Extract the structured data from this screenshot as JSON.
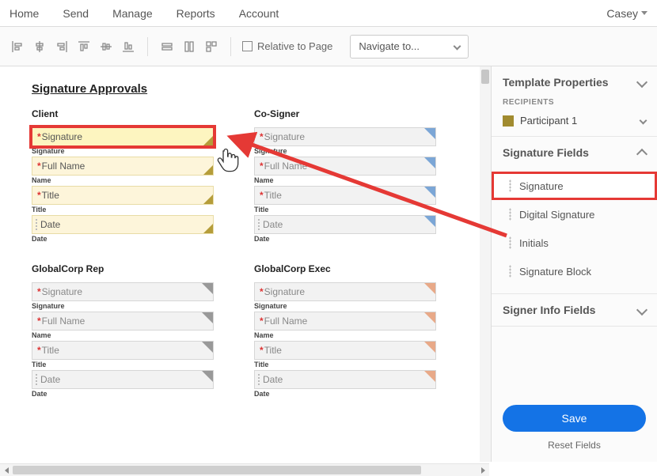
{
  "topnav": {
    "items": [
      "Home",
      "Send",
      "Manage",
      "Reports",
      "Account"
    ],
    "user": "Casey"
  },
  "toolbar": {
    "relative_label": "Relative to Page",
    "navigate_label": "Navigate to..."
  },
  "document": {
    "title": "Signature Approvals",
    "blocks": [
      {
        "heading": "Client",
        "tone": "yellow",
        "selected_field": 0,
        "fields": [
          {
            "placeholder": "Signature",
            "required": true,
            "label": "Signature"
          },
          {
            "placeholder": "Full Name",
            "required": true,
            "label": "Name"
          },
          {
            "placeholder": "Title",
            "required": true,
            "label": "Title"
          },
          {
            "placeholder": "Date",
            "required": false,
            "label": "Date",
            "date": true
          }
        ]
      },
      {
        "heading": "Co-Signer",
        "tone": "blue",
        "fields": [
          {
            "placeholder": "Signature",
            "required": true,
            "label": "Signature"
          },
          {
            "placeholder": "Full Name",
            "required": true,
            "label": "Name"
          },
          {
            "placeholder": "Title",
            "required": true,
            "label": "Title"
          },
          {
            "placeholder": "Date",
            "required": false,
            "label": "Date",
            "date": true
          }
        ]
      },
      {
        "heading": "GlobalCorp Rep",
        "tone": "grey",
        "fields": [
          {
            "placeholder": "Signature",
            "required": true,
            "label": "Signature"
          },
          {
            "placeholder": "Full Name",
            "required": true,
            "label": "Name"
          },
          {
            "placeholder": "Title",
            "required": true,
            "label": "Title"
          },
          {
            "placeholder": "Date",
            "required": false,
            "label": "Date",
            "date": true
          }
        ]
      },
      {
        "heading": "GlobalCorp Exec",
        "tone": "orange",
        "fields": [
          {
            "placeholder": "Signature",
            "required": true,
            "label": "Signature"
          },
          {
            "placeholder": "Full Name",
            "required": true,
            "label": "Name"
          },
          {
            "placeholder": "Title",
            "required": true,
            "label": "Title"
          },
          {
            "placeholder": "Date",
            "required": false,
            "label": "Date",
            "date": true
          }
        ]
      }
    ]
  },
  "sidebar": {
    "properties_title": "Template Properties",
    "recipients_label": "RECIPIENTS",
    "participant": "Participant 1",
    "sigfields_title": "Signature Fields",
    "sig_items": [
      "Signature",
      "Digital Signature",
      "Initials",
      "Signature Block"
    ],
    "sig_selected": 0,
    "signerinfo_title": "Signer Info Fields",
    "save_label": "Save",
    "reset_label": "Reset Fields"
  }
}
